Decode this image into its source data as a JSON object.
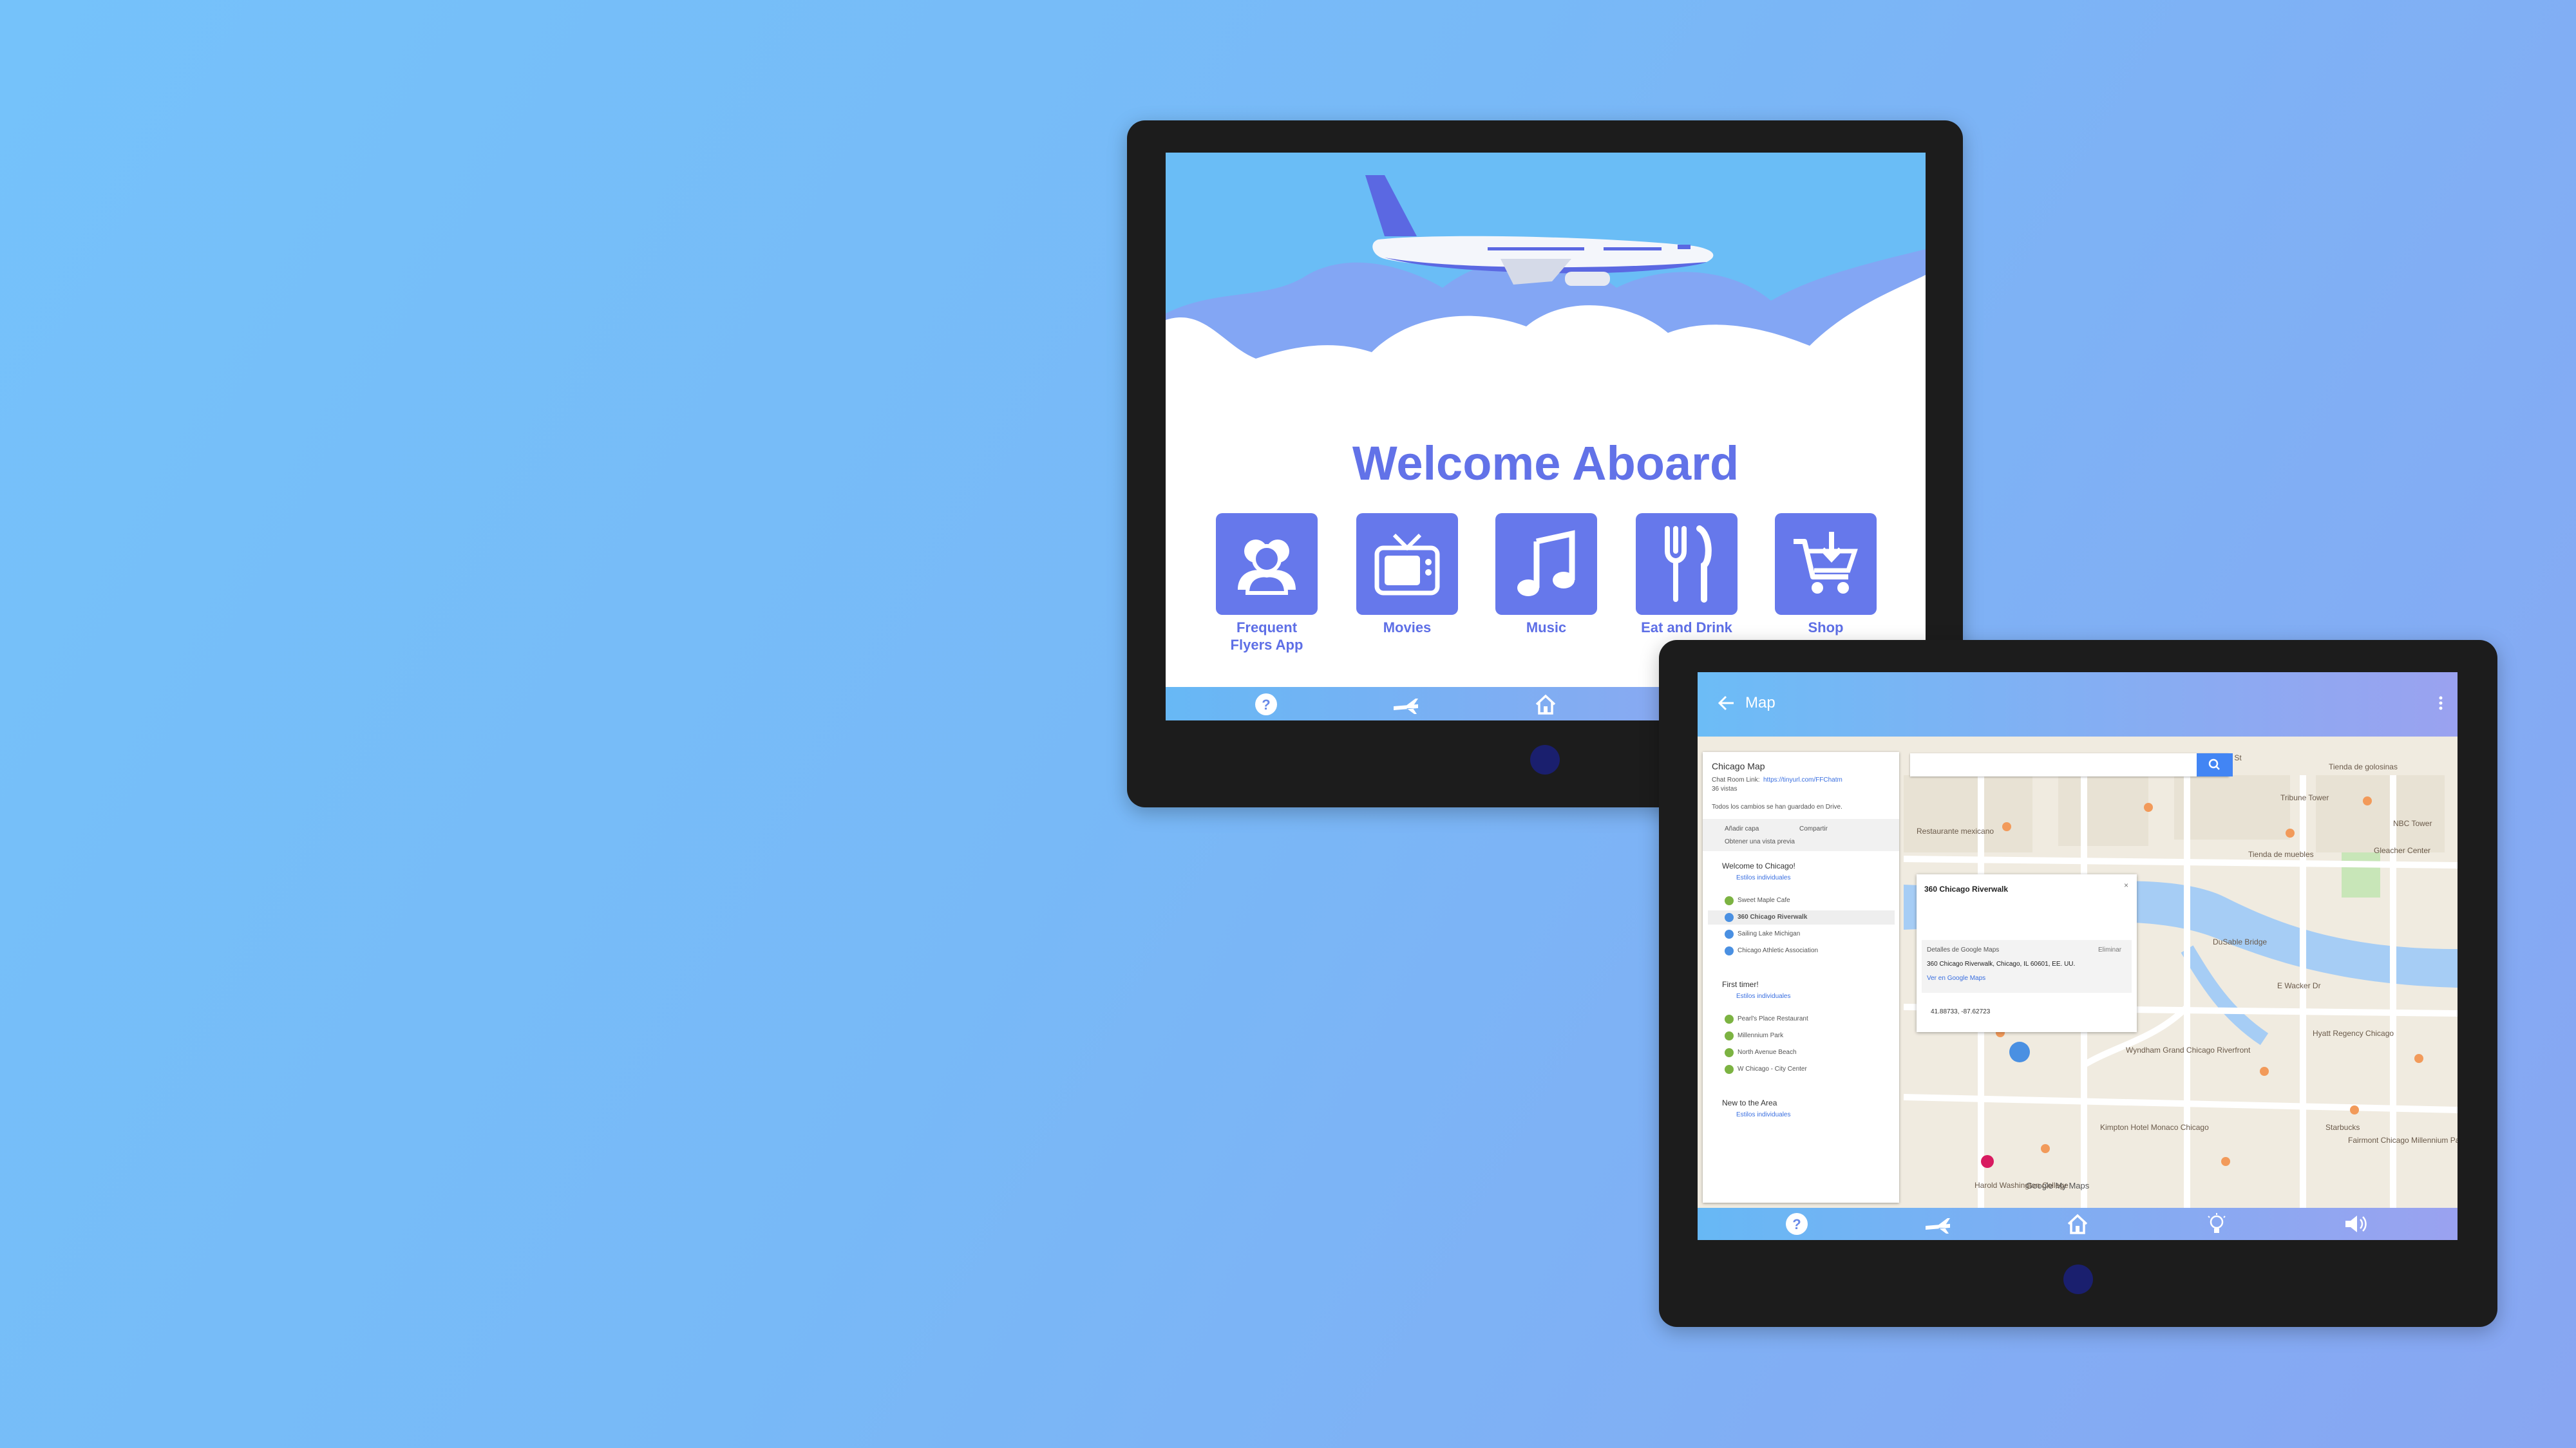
{
  "tablet1": {
    "welcome_title": "Welcome Aboard",
    "tiles": [
      {
        "label": "Frequent Flyers App",
        "icon": "people-icon"
      },
      {
        "label": "Movies",
        "icon": "tv-icon"
      },
      {
        "label": "Music",
        "icon": "music-note-icon"
      },
      {
        "label": "Eat and Drink",
        "icon": "fork-knife-icon"
      },
      {
        "label": "Shop",
        "icon": "shopping-cart-icon"
      }
    ],
    "nav": [
      "help-icon",
      "plane-icon",
      "home-icon"
    ]
  },
  "tablet2": {
    "header_title": "Map",
    "panel": {
      "map_title": "Chicago Map",
      "chat_link_prefix": "Chat Room Link:",
      "chat_link": "https://tinyurl.com/FFChatm",
      "views": "36 vistas",
      "saved_note": "Todos los cambios se han guardado en Drive.",
      "add_layer": "Añadir capa",
      "share": "Compartir",
      "preview": "Obtener una vista previa",
      "layers": [
        {
          "name": "Welcome to Chicago!",
          "style": "Estilos individuales",
          "items": [
            "Sweet Maple Cafe",
            "360 Chicago Riverwalk",
            "Sailing Lake Michigan",
            "Chicago Athletic Association"
          ]
        },
        {
          "name": "First timer!",
          "style": "Estilos individuales",
          "items": [
            "Pearl's Place Restaurant",
            "Millennium Park",
            "North Avenue Beach",
            "W Chicago - City Center"
          ]
        },
        {
          "name": "New to the Area",
          "style": "Estilos individuales",
          "items": []
        }
      ]
    },
    "popup": {
      "title": "360 Chicago Riverwalk",
      "details_label": "Detalles de Google Maps",
      "remove": "Eliminar",
      "address": "360 Chicago Riverwalk, Chicago, IL 60601, EE. UU.",
      "view_link": "Ver en Google Maps",
      "coords": "41.88733, -87.62723"
    },
    "map_labels": [
      "Tribune Tower",
      "Dearborn St",
      "DuSable Bridge",
      "E Wacker Dr",
      "Hyatt Regency Chicago",
      "Google My Maps",
      "Fairmont Chicago Millennium Park",
      "Restaurante mexicano",
      "Harold Washington College",
      "Tienda de golosinas",
      "Gleacher Center",
      "NBC Tower",
      "Tienda de muebles",
      "Starbucks",
      "Kimpton Hotel Monaco Chicago",
      "Wyndham Grand Chicago Riverfront"
    ],
    "nav": [
      "help-icon",
      "plane-icon",
      "home-icon",
      "lightbulb-icon",
      "speaker-icon"
    ]
  },
  "colors": {
    "accent": "#6678eb",
    "sky": "#6abdf6",
    "background": "#78b9f7"
  }
}
